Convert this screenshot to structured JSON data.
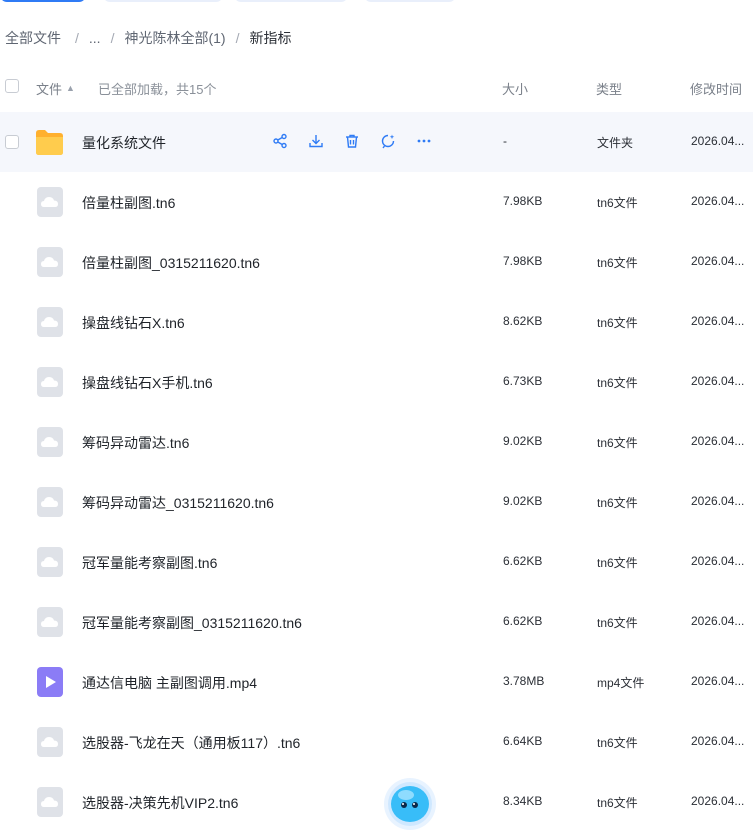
{
  "breadcrumb": {
    "items": [
      "全部文件",
      "...",
      "神光陈林全部(1)",
      "新指标"
    ],
    "separator": "/"
  },
  "header": {
    "name_label": "文件",
    "loaded_text": "已全部加载，共15个",
    "size_label": "大小",
    "type_label": "类型",
    "mtime_label": "修改时间"
  },
  "files": [
    {
      "name": "量化系统文件",
      "size": "-",
      "type": "文件夹",
      "mtime": "2026.04...",
      "icon": "folder-icon"
    },
    {
      "name": "倍量柱副图.tn6",
      "size": "7.98KB",
      "type": "tn6文件",
      "mtime": "2026.04...",
      "icon": "cloud-file-icon"
    },
    {
      "name": "倍量柱副图_0315211620.tn6",
      "size": "7.98KB",
      "type": "tn6文件",
      "mtime": "2026.04...",
      "icon": "cloud-file-icon"
    },
    {
      "name": "操盘线钻石X.tn6",
      "size": "8.62KB",
      "type": "tn6文件",
      "mtime": "2026.04...",
      "icon": "cloud-file-icon"
    },
    {
      "name": "操盘线钻石X手机.tn6",
      "size": "6.73KB",
      "type": "tn6文件",
      "mtime": "2026.04...",
      "icon": "cloud-file-icon"
    },
    {
      "name": "筹码异动雷达.tn6",
      "size": "9.02KB",
      "type": "tn6文件",
      "mtime": "2026.04...",
      "icon": "cloud-file-icon"
    },
    {
      "name": "筹码异动雷达_0315211620.tn6",
      "size": "9.02KB",
      "type": "tn6文件",
      "mtime": "2026.04...",
      "icon": "cloud-file-icon"
    },
    {
      "name": "冠军量能考察副图.tn6",
      "size": "6.62KB",
      "type": "tn6文件",
      "mtime": "2026.04...",
      "icon": "cloud-file-icon"
    },
    {
      "name": "冠军量能考察副图_0315211620.tn6",
      "size": "6.62KB",
      "type": "tn6文件",
      "mtime": "2026.04...",
      "icon": "cloud-file-icon"
    },
    {
      "name": "通达信电脑 主副图调用.mp4",
      "size": "3.78MB",
      "type": "mp4文件",
      "mtime": "2026.04...",
      "icon": "video-file-icon"
    },
    {
      "name": "选股器-飞龙在天（通用板117）.tn6",
      "size": "6.64KB",
      "type": "tn6文件",
      "mtime": "2026.04...",
      "icon": "cloud-file-icon"
    },
    {
      "name": "选股器-决策先机VIP2.tn6",
      "size": "8.34KB",
      "type": "tn6文件",
      "mtime": "2026.04...",
      "icon": "cloud-file-icon"
    }
  ],
  "row_actions": [
    "share-icon",
    "download-icon",
    "delete-icon",
    "ai-assist-icon",
    "more-icon"
  ],
  "colors": {
    "accent": "#2f7bf5",
    "folder": "#ffc53d",
    "video": "#8b7cf6",
    "cloud_file_bg": "#dfe2e8"
  }
}
